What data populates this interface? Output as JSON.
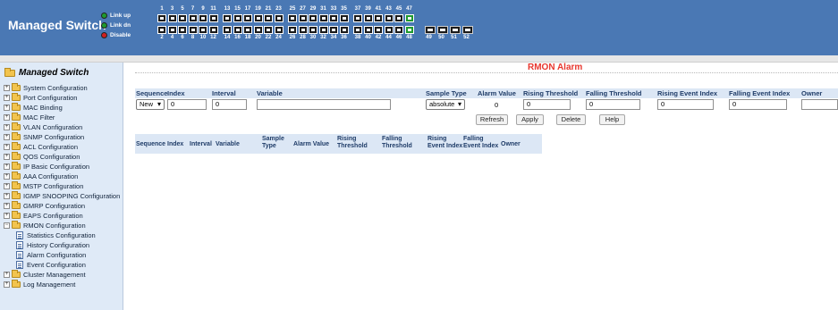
{
  "header": {
    "brand": "Managed Switch",
    "legend": [
      {
        "label": "Link up",
        "color": "#1f9a2f"
      },
      {
        "label": "Link dn",
        "color": "#1f9a2f"
      },
      {
        "label": "Disable",
        "color": "#d01f1f"
      }
    ],
    "top_port_numbers": [
      "1",
      "3",
      "5",
      "7",
      "9",
      "11",
      "13",
      "15",
      "17",
      "19",
      "21",
      "23",
      "25",
      "27",
      "29",
      "31",
      "33",
      "35",
      "37",
      "39",
      "41",
      "43",
      "45",
      "47"
    ],
    "bottom_port_numbers": [
      "2",
      "4",
      "6",
      "8",
      "10",
      "12",
      "14",
      "16",
      "18",
      "20",
      "22",
      "24",
      "26",
      "28",
      "30",
      "32",
      "34",
      "36",
      "38",
      "40",
      "42",
      "44",
      "46",
      "48",
      "49",
      "50",
      "51",
      "52"
    ]
  },
  "sidebar": {
    "title": "Managed Switch",
    "items": [
      {
        "label": "System Configuration",
        "type": "folder",
        "expand": "+"
      },
      {
        "label": "Port Configuration",
        "type": "folder",
        "expand": "+"
      },
      {
        "label": "MAC Binding",
        "type": "folder",
        "expand": "+"
      },
      {
        "label": "MAC Filter",
        "type": "folder",
        "expand": "+"
      },
      {
        "label": "VLAN Configuration",
        "type": "folder",
        "expand": "+"
      },
      {
        "label": "SNMP Configuration",
        "type": "folder",
        "expand": "+"
      },
      {
        "label": "ACL Configuration",
        "type": "folder",
        "expand": "+"
      },
      {
        "label": "QOS Configuration",
        "type": "folder",
        "expand": "+"
      },
      {
        "label": "IP Basic Configuration",
        "type": "folder",
        "expand": "+"
      },
      {
        "label": "AAA Configuration",
        "type": "folder",
        "expand": "+"
      },
      {
        "label": "MSTP Configuration",
        "type": "folder",
        "expand": "+"
      },
      {
        "label": "IGMP SNOOPING Configuration",
        "type": "folder",
        "expand": "+"
      },
      {
        "label": "GMRP Configuration",
        "type": "folder",
        "expand": "+"
      },
      {
        "label": "EAPS Configuration",
        "type": "folder",
        "expand": "+"
      },
      {
        "label": "RMON Configuration",
        "type": "folder",
        "expand": "−"
      },
      {
        "label": "Statistics Configuration",
        "type": "doc"
      },
      {
        "label": "History Configuration",
        "type": "doc"
      },
      {
        "label": "Alarm Configuration",
        "type": "doc"
      },
      {
        "label": "Event Configuration",
        "type": "doc"
      },
      {
        "label": "Cluster Management",
        "type": "folder",
        "expand": "+"
      },
      {
        "label": "Log Management",
        "type": "folder",
        "expand": "+"
      }
    ]
  },
  "main": {
    "title": "RMON Alarm",
    "form_headers": {
      "sequence": "Sequence",
      "index": "Index",
      "interval": "Interval",
      "variable": "Variable",
      "sample_type": "Sample Type",
      "alarm_value": "Alarm Value",
      "rising_threshold": "Rising Threshold",
      "falling_threshold": "Falling Threshold",
      "rising_event_index": "Rising Event Index",
      "falling_event_index": "Falling Event Index",
      "owner": "Owner"
    },
    "form_values": {
      "sequence": "New",
      "index": "0",
      "interval": "0",
      "variable": "",
      "sample_type": "absolute",
      "alarm_value": "0",
      "rising_threshold": "0",
      "falling_threshold": "0",
      "rising_event_index": "0",
      "falling_event_index": "0",
      "owner": ""
    },
    "buttons": {
      "refresh": "Refresh",
      "apply": "Apply",
      "delete": "Delete",
      "help": "Help"
    },
    "list_headers": {
      "sequence": "Sequence",
      "index": "Index",
      "interval": "Interval",
      "variable": "Variable",
      "sample_type": "Sample Type",
      "alarm_value": "Alarm Value",
      "rising_threshold": "Rising Threshold",
      "falling_threshold": "Falling Threshold",
      "rising_event_index": "Rising Event Index",
      "falling_event_index": "Falling Event Index",
      "owner": "Owner"
    }
  }
}
